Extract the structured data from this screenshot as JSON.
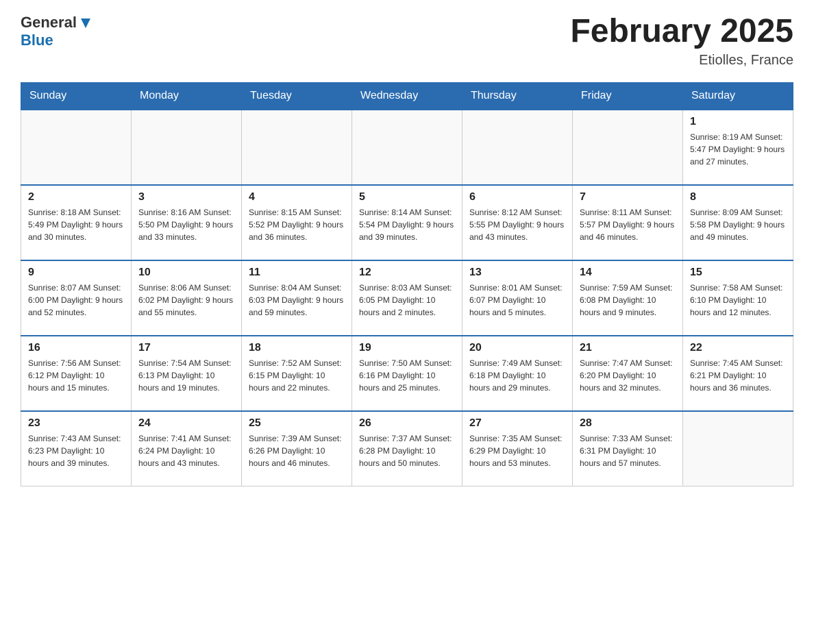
{
  "header": {
    "logo_general": "General",
    "logo_blue": "Blue",
    "title": "February 2025",
    "location": "Etiolles, France"
  },
  "days_of_week": [
    "Sunday",
    "Monday",
    "Tuesday",
    "Wednesday",
    "Thursday",
    "Friday",
    "Saturday"
  ],
  "weeks": [
    [
      {
        "day": "",
        "info": ""
      },
      {
        "day": "",
        "info": ""
      },
      {
        "day": "",
        "info": ""
      },
      {
        "day": "",
        "info": ""
      },
      {
        "day": "",
        "info": ""
      },
      {
        "day": "",
        "info": ""
      },
      {
        "day": "1",
        "info": "Sunrise: 8:19 AM\nSunset: 5:47 PM\nDaylight: 9 hours and 27 minutes."
      }
    ],
    [
      {
        "day": "2",
        "info": "Sunrise: 8:18 AM\nSunset: 5:49 PM\nDaylight: 9 hours and 30 minutes."
      },
      {
        "day": "3",
        "info": "Sunrise: 8:16 AM\nSunset: 5:50 PM\nDaylight: 9 hours and 33 minutes."
      },
      {
        "day": "4",
        "info": "Sunrise: 8:15 AM\nSunset: 5:52 PM\nDaylight: 9 hours and 36 minutes."
      },
      {
        "day": "5",
        "info": "Sunrise: 8:14 AM\nSunset: 5:54 PM\nDaylight: 9 hours and 39 minutes."
      },
      {
        "day": "6",
        "info": "Sunrise: 8:12 AM\nSunset: 5:55 PM\nDaylight: 9 hours and 43 minutes."
      },
      {
        "day": "7",
        "info": "Sunrise: 8:11 AM\nSunset: 5:57 PM\nDaylight: 9 hours and 46 minutes."
      },
      {
        "day": "8",
        "info": "Sunrise: 8:09 AM\nSunset: 5:58 PM\nDaylight: 9 hours and 49 minutes."
      }
    ],
    [
      {
        "day": "9",
        "info": "Sunrise: 8:07 AM\nSunset: 6:00 PM\nDaylight: 9 hours and 52 minutes."
      },
      {
        "day": "10",
        "info": "Sunrise: 8:06 AM\nSunset: 6:02 PM\nDaylight: 9 hours and 55 minutes."
      },
      {
        "day": "11",
        "info": "Sunrise: 8:04 AM\nSunset: 6:03 PM\nDaylight: 9 hours and 59 minutes."
      },
      {
        "day": "12",
        "info": "Sunrise: 8:03 AM\nSunset: 6:05 PM\nDaylight: 10 hours and 2 minutes."
      },
      {
        "day": "13",
        "info": "Sunrise: 8:01 AM\nSunset: 6:07 PM\nDaylight: 10 hours and 5 minutes."
      },
      {
        "day": "14",
        "info": "Sunrise: 7:59 AM\nSunset: 6:08 PM\nDaylight: 10 hours and 9 minutes."
      },
      {
        "day": "15",
        "info": "Sunrise: 7:58 AM\nSunset: 6:10 PM\nDaylight: 10 hours and 12 minutes."
      }
    ],
    [
      {
        "day": "16",
        "info": "Sunrise: 7:56 AM\nSunset: 6:12 PM\nDaylight: 10 hours and 15 minutes."
      },
      {
        "day": "17",
        "info": "Sunrise: 7:54 AM\nSunset: 6:13 PM\nDaylight: 10 hours and 19 minutes."
      },
      {
        "day": "18",
        "info": "Sunrise: 7:52 AM\nSunset: 6:15 PM\nDaylight: 10 hours and 22 minutes."
      },
      {
        "day": "19",
        "info": "Sunrise: 7:50 AM\nSunset: 6:16 PM\nDaylight: 10 hours and 25 minutes."
      },
      {
        "day": "20",
        "info": "Sunrise: 7:49 AM\nSunset: 6:18 PM\nDaylight: 10 hours and 29 minutes."
      },
      {
        "day": "21",
        "info": "Sunrise: 7:47 AM\nSunset: 6:20 PM\nDaylight: 10 hours and 32 minutes."
      },
      {
        "day": "22",
        "info": "Sunrise: 7:45 AM\nSunset: 6:21 PM\nDaylight: 10 hours and 36 minutes."
      }
    ],
    [
      {
        "day": "23",
        "info": "Sunrise: 7:43 AM\nSunset: 6:23 PM\nDaylight: 10 hours and 39 minutes."
      },
      {
        "day": "24",
        "info": "Sunrise: 7:41 AM\nSunset: 6:24 PM\nDaylight: 10 hours and 43 minutes."
      },
      {
        "day": "25",
        "info": "Sunrise: 7:39 AM\nSunset: 6:26 PM\nDaylight: 10 hours and 46 minutes."
      },
      {
        "day": "26",
        "info": "Sunrise: 7:37 AM\nSunset: 6:28 PM\nDaylight: 10 hours and 50 minutes."
      },
      {
        "day": "27",
        "info": "Sunrise: 7:35 AM\nSunset: 6:29 PM\nDaylight: 10 hours and 53 minutes."
      },
      {
        "day": "28",
        "info": "Sunrise: 7:33 AM\nSunset: 6:31 PM\nDaylight: 10 hours and 57 minutes."
      },
      {
        "day": "",
        "info": ""
      }
    ]
  ]
}
